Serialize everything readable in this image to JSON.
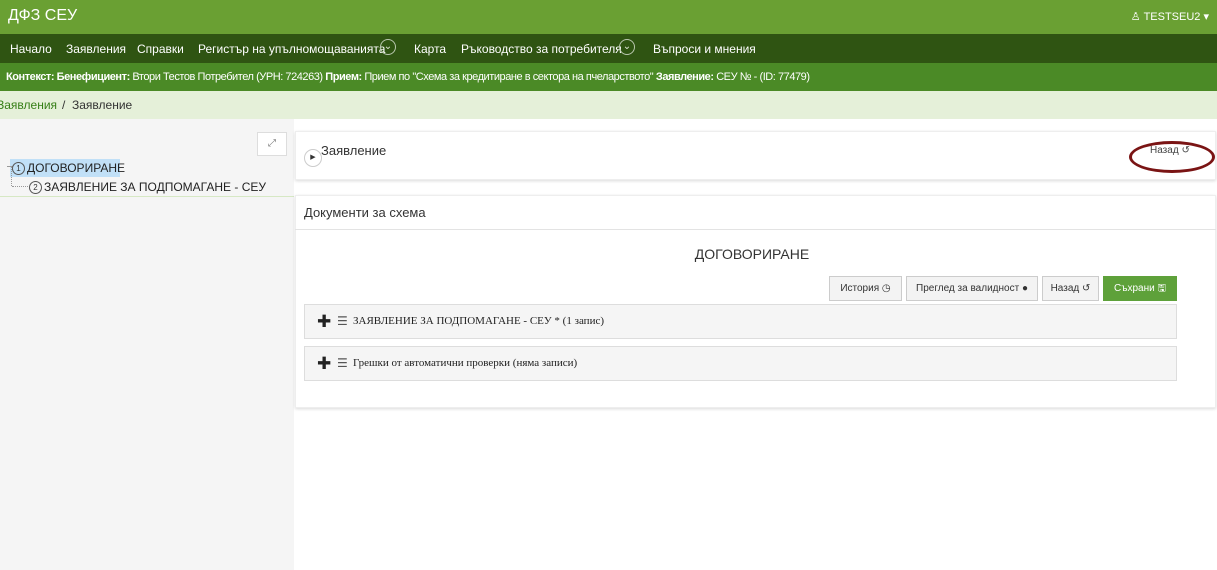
{
  "header": {
    "app_title": "ДФЗ СЕУ",
    "user": "TESTSEU2 ▾"
  },
  "nav": {
    "home": "Начало",
    "applications": "Заявления",
    "reports": "Справки",
    "register": "Регистър на упълномощаванията",
    "map": "Карта",
    "guide": "Ръководство за потребителя",
    "qa": "Въпроси и мнения"
  },
  "context": {
    "label_context": "Контекст:",
    "label_beneficiary": "Бенефициент:",
    "beneficiary": "Втори Тестов Потребител (УРН: 724263)",
    "label_intake": "Прием:",
    "intake": "Прием по \"Схема за кредитиране в сектора на пчеларството\"",
    "label_application": "Заявление:",
    "application": "СЕУ № - (ID: 77479)"
  },
  "breadcrumb": {
    "link": "Заявления",
    "separator": "/",
    "current": "Заявление"
  },
  "tree": {
    "nodes": [
      {
        "num": "1",
        "label": "ДОГОВОРИРАНЕ"
      },
      {
        "num": "2",
        "label": "ЗАЯВЛЕНИЕ ЗА ПОДПОМАГАНЕ - СЕУ"
      }
    ]
  },
  "card_header": {
    "title": "Заявление",
    "back_label": "Назад"
  },
  "documents": {
    "title": "Документи за схема",
    "section_title": "ДОГОВОРИРАНЕ",
    "buttons": {
      "history": "История",
      "validity": "Преглед за валидност",
      "back": "Назад",
      "save": "Съхрани"
    },
    "items": [
      {
        "label": "ЗАЯВЛЕНИЕ ЗА ПОДПОМАГАНЕ - СЕУ * (1 запис)"
      },
      {
        "label": "Грешки от автоматични проверки (няма записи)"
      }
    ]
  },
  "colors": {
    "topbar": "#6aa033",
    "navbar": "#2f5412",
    "contextbar": "#4b8a26",
    "breadcrumb": "#e5f0d9",
    "save_button": "#5ea13a",
    "highlight_ellipse": "#7a1414"
  }
}
